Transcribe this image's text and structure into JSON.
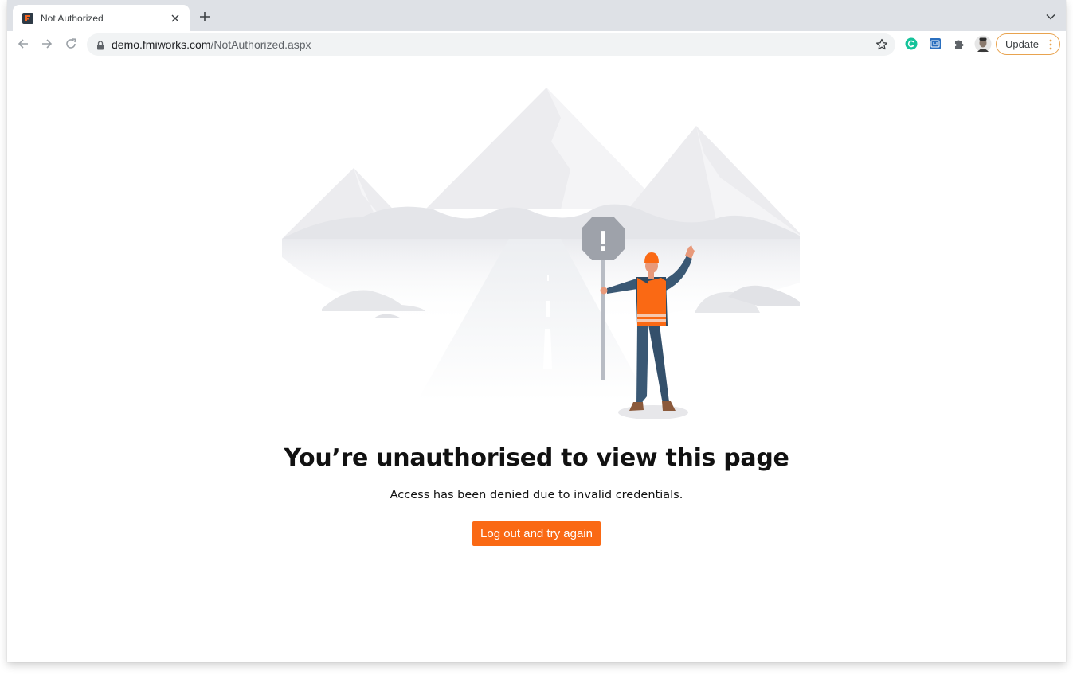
{
  "browser": {
    "tab": {
      "title": "Not Authorized",
      "favicon_color": "#f26522"
    },
    "address_bar": {
      "domain": "demo.fmiworks.com",
      "path": "/NotAuthorized.aspx"
    },
    "update_button_label": "Update",
    "accent_color": "#e8a34f"
  },
  "page": {
    "heading": "You’re unauthorised to view this page",
    "message": "Access has been denied due to invalid credentials.",
    "button_label": "Log out and try again",
    "button_color": "#fa6914",
    "sign_symbol": "!"
  }
}
